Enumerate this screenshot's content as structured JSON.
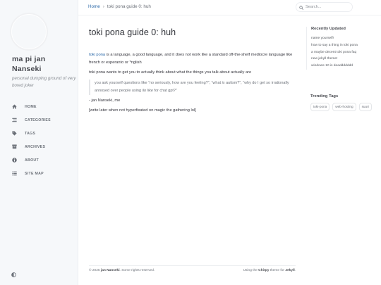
{
  "sidebar": {
    "title_line1": "ma pi jan",
    "title_line2": "Nanseki",
    "subtitle": "personal dumping ground of very bored joker",
    "nav": [
      {
        "label": "HOME",
        "icon": "home-icon"
      },
      {
        "label": "CATEGORIES",
        "icon": "stream-icon"
      },
      {
        "label": "TAGS",
        "icon": "tag-icon"
      },
      {
        "label": "ARCHIVES",
        "icon": "archive-icon"
      },
      {
        "label": "ABOUT",
        "icon": "info-icon"
      },
      {
        "label": "SITE MAP",
        "icon": "list-icon"
      }
    ],
    "mode_toggle_icon": "adjust-icon"
  },
  "topbar": {
    "breadcrumb_home": "Home",
    "breadcrumb_sep": "›",
    "breadcrumb_current": "toki pona guide 0: huh",
    "search_placeholder": "Search..."
  },
  "post": {
    "title": "toki pona guide 0: huh",
    "p1_link": "toki pona",
    "p1_rest": " is a language, a good language, and it does not work like a standard off-the-shelf mediocre language like french or esperanto or *nglish",
    "p2": "toki pona wants to get you to actually think about what the things you talk about actually are",
    "quote_a": "you ask yourself questions like “no seriously, how are you feeling?”, “what ",
    "quote_b": "is",
    "quote_c": " autism?”, “why do I get so irrationally annoyed over people using ",
    "quote_d": "ilo like",
    "quote_e": " for chat gpt?”",
    "p3": "- jan Nanseki, me",
    "p4": "[write later when not hyperfixated on magic the gathering lol]"
  },
  "panel": {
    "recent_title": "Recently Updated",
    "recent": [
      "name yourself!",
      "how to say a thing in toki pona",
      "a maybe decent toki pona faq",
      "new jekyll theme!",
      "windows 10 is deaddddddd"
    ],
    "tags_title": "Trending Tags",
    "tags": [
      "toki-pona",
      "web-hosting",
      "suuri"
    ]
  },
  "footer": {
    "left_prefix": "© 2025 ",
    "left_name": "jan Nanseki",
    "left_suffix": ". Some rights reserved.",
    "right_prefix": "Using the ",
    "right_theme": "Chirpy",
    "right_mid": " theme for ",
    "right_jekyll": "Jekyll",
    "right_suffix": "."
  },
  "colors": {
    "accent": "#2a68a8",
    "sidebar_bg": "#f6f8fa",
    "text": "#34343c"
  }
}
